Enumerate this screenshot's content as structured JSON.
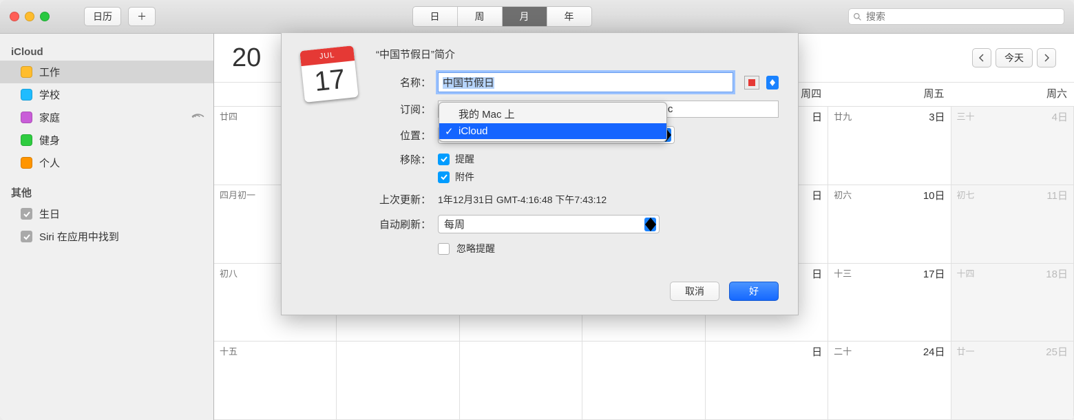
{
  "toolbar": {
    "calendar_btn": "日历",
    "add_btn": "＋",
    "view_seg": [
      "日",
      "周",
      "月",
      "年"
    ],
    "active_view": 2,
    "search_placeholder": "搜索"
  },
  "sidebar": {
    "group1": "iCloud",
    "group1_items": [
      {
        "label": "工作",
        "color": "#ffbd2e",
        "selected": true
      },
      {
        "label": "学校",
        "color": "#1fbcff"
      },
      {
        "label": "家庭",
        "color": "#c95dd8",
        "broadcast": true
      },
      {
        "label": "健身",
        "color": "#2ecc40"
      },
      {
        "label": "个人",
        "color": "#ff9500"
      }
    ],
    "group2": "其他",
    "group2_items": [
      {
        "label": "生日"
      },
      {
        "label": "Siri 在应用中找到"
      }
    ]
  },
  "main": {
    "month_title_partial": "20",
    "today_label": "今天",
    "day_headers": [
      "",
      "",
      "",
      "",
      "周四",
      "周五",
      "周六"
    ]
  },
  "calendar_cells": [
    [
      {
        "l": "廿四"
      },
      {},
      {},
      {},
      {
        "l": "",
        "n": "日"
      },
      {
        "l": "廿九",
        "n": "3日"
      },
      {
        "l": "三十",
        "n": "4日",
        "o": true
      }
    ],
    [
      {
        "l": "四月初一"
      },
      {},
      {},
      {},
      {
        "l": "",
        "n": "日"
      },
      {
        "l": "初六",
        "n": "10日"
      },
      {
        "l": "初七",
        "n": "11日",
        "o": true
      }
    ],
    [
      {
        "l": "初八"
      },
      {},
      {},
      {},
      {
        "l": "",
        "n": "日"
      },
      {
        "l": "十三",
        "n": "17日"
      },
      {
        "l": "十四",
        "n": "18日",
        "o": true
      }
    ],
    [
      {
        "l": "十五"
      },
      {},
      {},
      {},
      {
        "l": "",
        "n": "日"
      },
      {
        "l": "二十",
        "n": "24日"
      },
      {
        "l": "廿一",
        "n": "25日",
        "o": true
      }
    ]
  ],
  "dialog": {
    "icon_month": "JUL",
    "icon_day": "17",
    "title": "“中国节假日”简介",
    "name_lbl": "名称：",
    "name_val": "中国节假日",
    "color_val": "#e53935",
    "sub_lbl": "订阅：",
    "sub_val": "https://p48-calendars.icloud.com/holidays/cn_zh.ic",
    "loc_lbl": "位置：",
    "loc_options": [
      "我的 Mac 上",
      "iCloud"
    ],
    "loc_selected": 1,
    "remove_lbl": "移除：",
    "remove_items": [
      "提醒",
      "附件"
    ],
    "updated_lbl": "上次更新：",
    "updated_val": "1年12月31日 GMT-4:16:48 下午7:43:12",
    "refresh_lbl": "自动刷新：",
    "refresh_val": "每周",
    "ignore_lbl": "忽略提醒",
    "cancel": "取消",
    "ok": "好"
  }
}
